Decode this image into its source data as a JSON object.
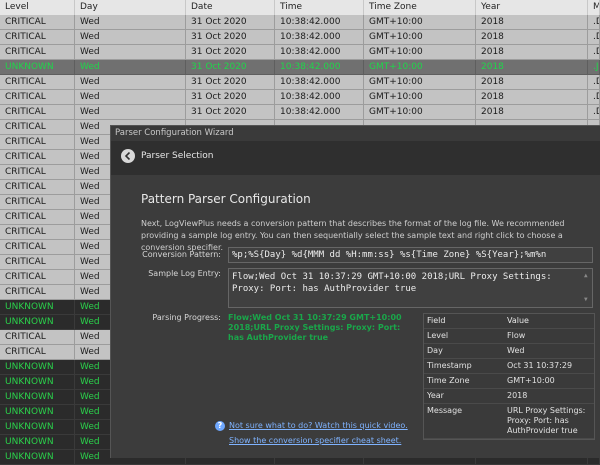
{
  "columns": [
    "Level",
    "Day",
    "Date",
    "Time",
    "Time Zone",
    "Year",
    "M"
  ],
  "rows": [
    {
      "level": "CRITICAL",
      "day": "Wed",
      "date": "31 Oct 2020",
      "time": "10:38:42.000",
      "tz": "GMT+10:00",
      "year": "2018",
      "m": ".D",
      "kind": "crit"
    },
    {
      "level": "CRITICAL",
      "day": "Wed",
      "date": "31 Oct 2020",
      "time": "10:38:42.000",
      "tz": "GMT+10:00",
      "year": "2018",
      "m": ".D",
      "kind": "crit"
    },
    {
      "level": "CRITICAL",
      "day": "Wed",
      "date": "31 Oct 2020",
      "time": "10:38:42.000",
      "tz": "GMT+10:00",
      "year": "2018",
      "m": ".D",
      "kind": "crit"
    },
    {
      "level": "UNKNOWN",
      "day": "Wed",
      "date": "31 Oct 2020",
      "time": "10:38:42.000",
      "tz": "GMT+10:00",
      "year": "2018",
      "m": ".J",
      "kind": "sel"
    },
    {
      "level": "CRITICAL",
      "day": "Wed",
      "date": "31 Oct 2020",
      "time": "10:38:42.000",
      "tz": "GMT+10:00",
      "year": "2018",
      "m": ".D",
      "kind": "crit"
    },
    {
      "level": "CRITICAL",
      "day": "Wed",
      "date": "31 Oct 2020",
      "time": "10:38:42.000",
      "tz": "GMT+10:00",
      "year": "2018",
      "m": ".D",
      "kind": "crit"
    },
    {
      "level": "CRITICAL",
      "day": "Wed",
      "date": "31 Oct 2020",
      "time": "10:38:42.000",
      "tz": "GMT+10:00",
      "year": "2018",
      "m": ".D",
      "kind": "crit"
    },
    {
      "level": "CRITICAL",
      "day": "Wed",
      "date": "",
      "time": "",
      "tz": "",
      "year": "",
      "m": "",
      "kind": "crit"
    },
    {
      "level": "CRITICAL",
      "day": "Wed",
      "date": "",
      "time": "",
      "tz": "",
      "year": "",
      "m": "",
      "kind": "crit"
    },
    {
      "level": "CRITICAL",
      "day": "Wed",
      "date": "",
      "time": "",
      "tz": "",
      "year": "",
      "m": "",
      "kind": "crit"
    },
    {
      "level": "CRITICAL",
      "day": "Wed",
      "date": "",
      "time": "",
      "tz": "",
      "year": "",
      "m": "",
      "kind": "crit"
    },
    {
      "level": "CRITICAL",
      "day": "Wed",
      "date": "",
      "time": "",
      "tz": "",
      "year": "",
      "m": "",
      "kind": "crit"
    },
    {
      "level": "CRITICAL",
      "day": "Wed",
      "date": "",
      "time": "",
      "tz": "",
      "year": "",
      "m": "",
      "kind": "crit"
    },
    {
      "level": "CRITICAL",
      "day": "Wed",
      "date": "",
      "time": "",
      "tz": "",
      "year": "",
      "m": "",
      "kind": "crit"
    },
    {
      "level": "CRITICAL",
      "day": "Wed",
      "date": "",
      "time": "",
      "tz": "",
      "year": "",
      "m": "",
      "kind": "crit"
    },
    {
      "level": "CRITICAL",
      "day": "Wed",
      "date": "",
      "time": "",
      "tz": "",
      "year": "",
      "m": "",
      "kind": "crit"
    },
    {
      "level": "CRITICAL",
      "day": "Wed",
      "date": "",
      "time": "",
      "tz": "",
      "year": "",
      "m": "",
      "kind": "crit"
    },
    {
      "level": "CRITICAL",
      "day": "Wed",
      "date": "",
      "time": "",
      "tz": "",
      "year": "",
      "m": "",
      "kind": "crit"
    },
    {
      "level": "CRITICAL",
      "day": "Wed",
      "date": "",
      "time": "",
      "tz": "",
      "year": "",
      "m": "",
      "kind": "crit"
    },
    {
      "level": "UNKNOWN",
      "day": "Wed",
      "date": "",
      "time": "",
      "tz": "",
      "year": "",
      "m": "",
      "kind": "unk"
    },
    {
      "level": "UNKNOWN",
      "day": "Wed",
      "date": "",
      "time": "",
      "tz": "",
      "year": "",
      "m": "",
      "kind": "unk"
    },
    {
      "level": "CRITICAL",
      "day": "Wed",
      "date": "",
      "time": "",
      "tz": "",
      "year": "",
      "m": "",
      "kind": "crit"
    },
    {
      "level": "CRITICAL",
      "day": "Wed",
      "date": "",
      "time": "",
      "tz": "",
      "year": "",
      "m": "",
      "kind": "crit"
    },
    {
      "level": "UNKNOWN",
      "day": "Wed",
      "date": "",
      "time": "",
      "tz": "",
      "year": "",
      "m": "",
      "kind": "unk"
    },
    {
      "level": "UNKNOWN",
      "day": "Wed",
      "date": "",
      "time": "",
      "tz": "",
      "year": "",
      "m": "",
      "kind": "unk"
    },
    {
      "level": "UNKNOWN",
      "day": "Wed",
      "date": "",
      "time": "",
      "tz": "",
      "year": "",
      "m": "",
      "kind": "unk"
    },
    {
      "level": "UNKNOWN",
      "day": "Wed",
      "date": "",
      "time": "",
      "tz": "",
      "year": "",
      "m": "",
      "kind": "unk"
    },
    {
      "level": "UNKNOWN",
      "day": "Wed",
      "date": "",
      "time": "",
      "tz": "",
      "year": "",
      "m": "",
      "kind": "unk"
    },
    {
      "level": "UNKNOWN",
      "day": "Wed",
      "date": "",
      "time": "",
      "tz": "",
      "year": "",
      "m": "",
      "kind": "unk"
    },
    {
      "level": "UNKNOWN",
      "day": "Wed",
      "date": "",
      "time": "",
      "tz": "",
      "year": "",
      "m": "",
      "kind": "unk"
    }
  ],
  "dialog": {
    "window_title": "Parser Configuration Wizard",
    "nav_title": "Parser Selection",
    "heading": "Pattern Parser Configuration",
    "description": "Next, LogViewPlus needs a conversion pattern that describes the format of the log file.  We recommended providing a sample log entry.  You can then sequentially select the sample text and right click to choose a conversion specifier.",
    "conversion_label": "Conversion Pattern:",
    "conversion_value": "%p;%S{Day} %d{MMM dd %H:mm:ss} %s{Time Zone} %S{Year};%m%n",
    "sample_label": "Sample Log Entry:",
    "sample_value": "Flow;Wed Oct 31 10:37:29 GMT+10:00 2018;URL Proxy Settings: Proxy:  Port:  has AuthProvider true",
    "progress_label": "Parsing Progress:",
    "progress_text": "Flow;Wed Oct 31 10:37:29 GMT+10:00 2018;URL Proxy Settings: Proxy:  Port:  has AuthProvider true",
    "result_header": {
      "field": "Field",
      "value": "Value"
    },
    "results": [
      {
        "field": "Level",
        "value": "Flow"
      },
      {
        "field": "Day",
        "value": "Wed"
      },
      {
        "field": "Timestamp",
        "value": "Oct 31 10:37:29"
      },
      {
        "field": "Time Zone",
        "value": "GMT+10:00"
      },
      {
        "field": "Year",
        "value": "2018"
      },
      {
        "field": "Message",
        "value": "URL Proxy Settings: Proxy:  Port:  has AuthProvider true"
      }
    ],
    "help_link": "Not sure what to do?  Watch this quick video.",
    "cheat_link": "Show the conversion specifier cheat sheet."
  },
  "colors": {
    "critical_bg": "#c3c3c3",
    "unknown_text": "#2bd14b",
    "link": "#7fb3ff",
    "progress": "#1aa64a"
  },
  "icons": [
    "back-arrow-icon",
    "help-icon"
  ]
}
